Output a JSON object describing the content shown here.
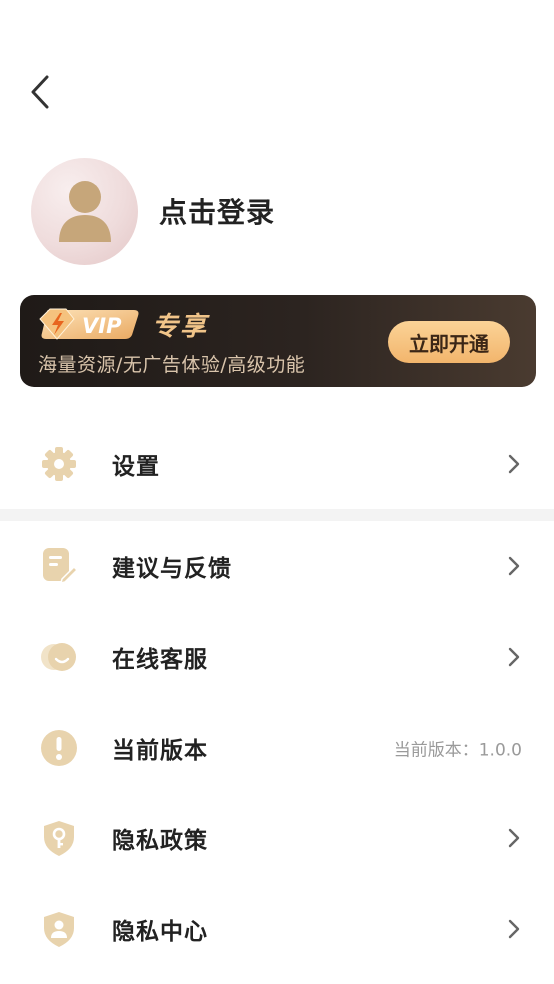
{
  "header": {
    "back_icon": "chevron-left-icon"
  },
  "profile": {
    "avatar_icon": "user-avatar-icon",
    "login_label": "点击登录"
  },
  "vip": {
    "badge_text": "VIP",
    "title": "专享",
    "description": "海量资源/无广告体验/高级功能",
    "open_button_label": "立即开通",
    "colors": {
      "gold": "#f1c489",
      "button": "#f2b56c",
      "background": "#2c2420"
    }
  },
  "menu": {
    "settings": {
      "label": "设置",
      "icon": "gear-icon"
    },
    "feedback": {
      "label": "建议与反馈",
      "icon": "note-edit-icon"
    },
    "customer_service": {
      "label": "在线客服",
      "icon": "chat-bubble-icon"
    },
    "version": {
      "label": "当前版本",
      "value": "当前版本：1.0.0",
      "icon": "exclamation-circle-icon"
    },
    "privacy_policy": {
      "label": "隐私政策",
      "icon": "shield-key-icon"
    },
    "privacy_center": {
      "label": "隐私中心",
      "icon": "shield-user-icon"
    }
  },
  "accent_color": "#e8d3ad"
}
